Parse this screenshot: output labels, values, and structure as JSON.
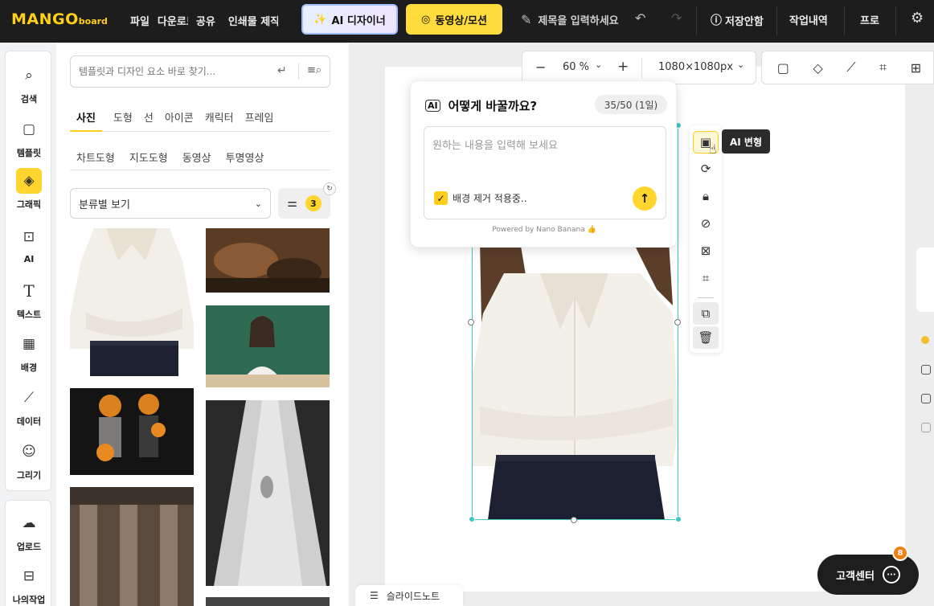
{
  "topbar": {
    "logo": "MANGO",
    "logo_sub": "board",
    "nav": [
      "파일",
      "다운로드",
      "공유",
      "인쇄물 제작"
    ],
    "ai_designer": "AI 디자이너",
    "video_motion": "동영상/모션",
    "title_placeholder": "제목을 입력하세요",
    "save_status": "저장안함",
    "history": "작업내역",
    "pro": "프로"
  },
  "rail": {
    "items": [
      {
        "label": "검색",
        "icon": "search-icon"
      },
      {
        "label": "템플릿",
        "icon": "template-icon"
      },
      {
        "label": "그래픽",
        "icon": "graphic-icon"
      },
      {
        "label": "AI",
        "icon": "ai-chip-icon"
      },
      {
        "label": "텍스트",
        "icon": "text-icon"
      },
      {
        "label": "배경",
        "icon": "background-icon"
      },
      {
        "label": "데이터",
        "icon": "chart-icon"
      },
      {
        "label": "그리기",
        "icon": "draw-icon"
      }
    ],
    "bottom": [
      {
        "label": "업로드",
        "icon": "upload-icon"
      },
      {
        "label": "나의작업",
        "icon": "my-work-icon"
      }
    ]
  },
  "panel": {
    "search_placeholder": "템플릿과 디자인 요소 바로 찾기...",
    "tabs1": [
      "사진",
      "도형",
      "선",
      "아이콘",
      "캐릭터",
      "프레임"
    ],
    "tabs2": [
      "차트도형",
      "지도도형",
      "동영상",
      "투명영상"
    ],
    "sort": "분류별 보기",
    "filter_count": "3"
  },
  "canvas": {
    "zoom": "60 %",
    "size": "1080×1080px"
  },
  "ai_popup": {
    "title": "어떻게 바꿀까요?",
    "count": "35/50 (1일)",
    "placeholder": "원하는 내용을 입력해 보세요",
    "bg_removed": "배경 제거 적용중..",
    "powered": "Powered by Nano Banana 👍"
  },
  "tooltip": "AI 변형",
  "slide_note": "슬라이드노트",
  "help": {
    "label": "고객센터",
    "badge": "8"
  },
  "colors": {
    "accent": "#ffd52e",
    "selection": "#3dc8c8",
    "topbar": "#1d1d1d"
  }
}
